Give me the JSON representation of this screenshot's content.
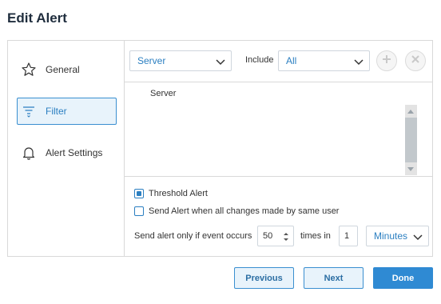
{
  "dialog": {
    "title": "Edit Alert"
  },
  "sidebar": {
    "items": [
      {
        "label": "General",
        "icon": "star-icon",
        "active": false
      },
      {
        "label": "Filter",
        "icon": "filter-icon",
        "active": true
      },
      {
        "label": "Alert Settings",
        "icon": "bell-icon",
        "active": false
      }
    ]
  },
  "filter": {
    "type_select": {
      "value": "Server"
    },
    "include_label": "Include",
    "include_select": {
      "value": "All"
    },
    "list_items": [
      "Server"
    ]
  },
  "options": {
    "threshold": {
      "label": "Threshold Alert",
      "checked": true
    },
    "same_user": {
      "label": "Send Alert when all changes made by same user",
      "checked": false
    },
    "frequency": {
      "label": "Send alert only if event occurs",
      "count": "50",
      "times_label": "times in",
      "period": "1",
      "unit": "Minutes"
    }
  },
  "footer": {
    "previous": "Previous",
    "next": "Next",
    "done": "Done"
  },
  "colors": {
    "accent": "#2f8ad3",
    "active_bg": "#e8f3fb",
    "border": "#d9d9d9"
  }
}
